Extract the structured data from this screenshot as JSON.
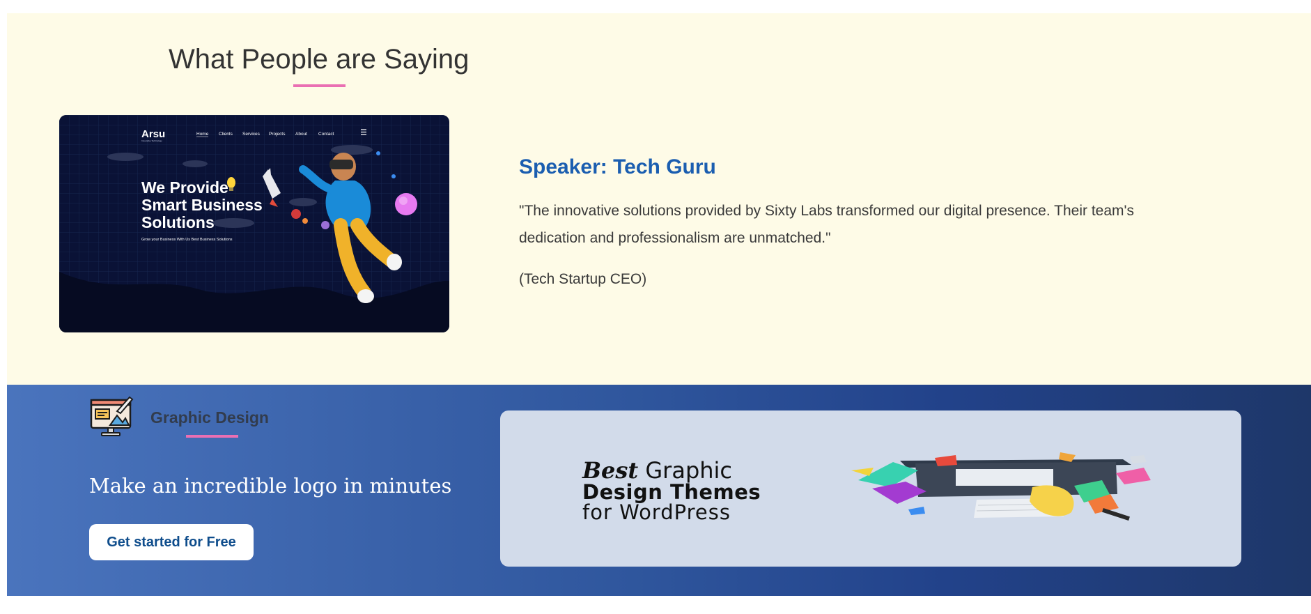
{
  "testimonials": {
    "title": "What People are Saying",
    "speaker": "Speaker: Tech Guru",
    "quote": "\"The innovative solutions provided by Sixty Labs transformed our digital presence. Their team's dedication and professionalism are unmatched.\"",
    "role": "(Tech Startup CEO)",
    "image": {
      "logo": "Arsu",
      "logo_tagline": "Innovative Technology",
      "nav": [
        "Home",
        "Clients",
        "Services",
        "Projects",
        "About",
        "Contact"
      ],
      "headline": [
        "We Provide",
        "Smart Business",
        "Solutions"
      ],
      "subtext": "Grow your Business With Us Best Business Solutions"
    }
  },
  "promo": {
    "icon": "graphic-design-monitor-icon",
    "category": "Graphic Design",
    "heading": "Make an incredible logo in minutes",
    "cta_label": "Get started for Free",
    "banner": {
      "word_best": "Best",
      "line1_rest": " Graphic",
      "line2": "Design Themes",
      "line3": "for WordPress"
    }
  },
  "colors": {
    "testimonial_bg": "#fefbe7",
    "accent_pink": "#ea6fb3",
    "speaker_blue": "#1b5eb0",
    "promo_gradient_start": "#4a74bd",
    "promo_gradient_end": "#1e3769",
    "banner_bg": "#d2dbea"
  }
}
